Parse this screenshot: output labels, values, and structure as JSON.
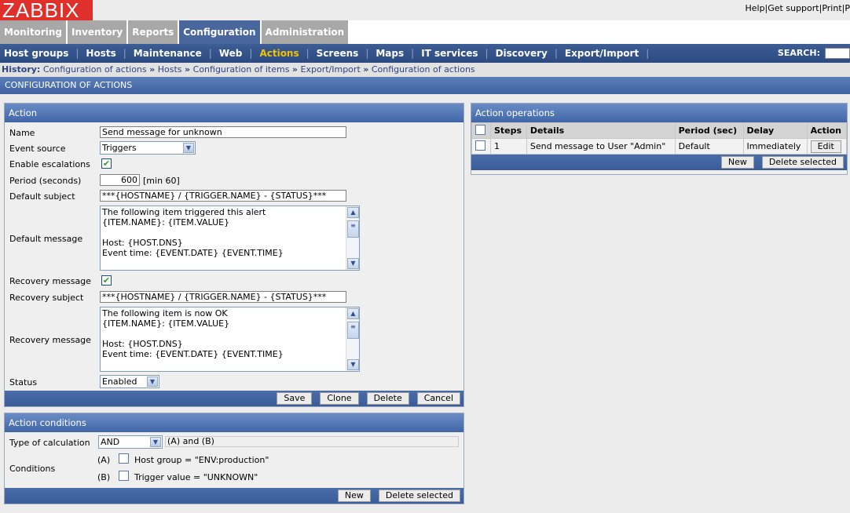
{
  "logo": "ZABBIX",
  "top_links": [
    "Help",
    "Get support",
    "Print",
    "P"
  ],
  "main_tabs": [
    "Monitoring",
    "Inventory",
    "Reports",
    "Configuration",
    "Administration"
  ],
  "sub_nav": [
    "Host groups",
    "Hosts",
    "Maintenance",
    "Web",
    "Actions",
    "Screens",
    "Maps",
    "IT services",
    "Discovery",
    "Export/Import"
  ],
  "search_label": "SEARCH:",
  "history": {
    "label": "History:",
    "items": [
      "Configuration of actions",
      "Hosts",
      "Configuration of items",
      "Export/Import",
      "Configuration of actions"
    ]
  },
  "page_title": "CONFIGURATION OF ACTIONS",
  "action": {
    "title": "Action",
    "name_label": "Name",
    "name_value": "Send message for unknown",
    "event_source_label": "Event source",
    "event_source_value": "Triggers",
    "escalations_label": "Enable escalations",
    "period_label": "Period (seconds)",
    "period_value": "600",
    "period_hint": "[min 60]",
    "default_subject_label": "Default subject",
    "default_subject_value": "***{HOSTNAME} / {TRIGGER.NAME} - {STATUS}***",
    "default_message_label": "Default message",
    "default_message_value": "The following item triggered this alert\n{ITEM.NAME}: {ITEM.VALUE}\n\nHost: {HOST.DNS}\nEvent time: {EVENT.DATE} {EVENT.TIME}\n\nEvent Details:",
    "recovery_message_cb_label": "Recovery message",
    "recovery_subject_label": "Recovery subject",
    "recovery_subject_value": "***{HOSTNAME} / {TRIGGER.NAME} - {STATUS}***",
    "recovery_message_label": "Recovery message",
    "recovery_message_value": "The following item is now OK\n{ITEM.NAME}: {ITEM.VALUE}\n\nHost: {HOST.DNS}\nEvent time: {EVENT.DATE} {EVENT.TIME}\n\nEvent Details:",
    "status_label": "Status",
    "status_value": "Enabled",
    "buttons": [
      "Save",
      "Clone",
      "Delete",
      "Cancel"
    ]
  },
  "conditions": {
    "title": "Action conditions",
    "calc_label": "Type of calculation",
    "calc_value": "AND",
    "calc_formula": "(A) and (B)",
    "conditions_label": "Conditions",
    "items": [
      {
        "letter": "(A)",
        "text": "Host group = \"ENV:production\""
      },
      {
        "letter": "(B)",
        "text": "Trigger value = \"UNKNOWN\""
      }
    ],
    "buttons": [
      "New",
      "Delete selected"
    ]
  },
  "operations": {
    "title": "Action operations",
    "headers": [
      "Steps",
      "Details",
      "Period (sec)",
      "Delay",
      "Action"
    ],
    "rows": [
      {
        "steps": "1",
        "details": "Send message to User \"Admin\"",
        "period": "Default",
        "delay": "Immediately",
        "action": "Edit"
      }
    ],
    "buttons": [
      "New",
      "Delete selected"
    ]
  }
}
